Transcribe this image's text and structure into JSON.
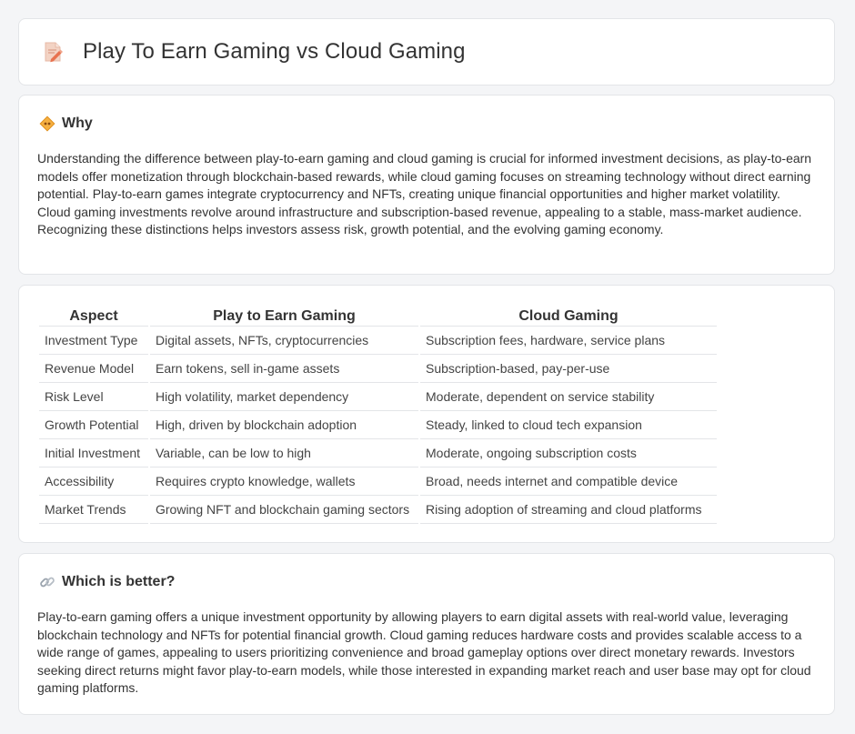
{
  "header": {
    "title": "Play To Earn Gaming vs Cloud Gaming",
    "icon": "document-pencil-icon"
  },
  "why": {
    "icon": "diamond-sign-icon",
    "heading": "Why",
    "text": "Understanding the difference between play-to-earn gaming and cloud gaming is crucial for informed investment decisions, as play-to-earn models offer monetization through blockchain-based rewards, while cloud gaming focuses on streaming technology without direct earning potential. Play-to-earn games integrate cryptocurrency and NFTs, creating unique financial opportunities and higher market volatility. Cloud gaming investments revolve around infrastructure and subscription-based revenue, appealing to a stable, mass-market audience. Recognizing these distinctions helps investors assess risk, growth potential, and the evolving gaming economy."
  },
  "table": {
    "headers": [
      "Aspect",
      "Play to Earn Gaming",
      "Cloud Gaming"
    ],
    "rows": [
      [
        "Investment Type",
        "Digital assets, NFTs, cryptocurrencies",
        "Subscription fees, hardware, service plans"
      ],
      [
        "Revenue Model",
        "Earn tokens, sell in-game assets",
        "Subscription-based, pay-per-use"
      ],
      [
        "Risk Level",
        "High volatility, market dependency",
        "Moderate, dependent on service stability"
      ],
      [
        "Growth Potential",
        "High, driven by blockchain adoption",
        "Steady, linked to cloud tech expansion"
      ],
      [
        "Initial Investment",
        "Variable, can be low to high",
        "Moderate, ongoing subscription costs"
      ],
      [
        "Accessibility",
        "Requires crypto knowledge, wallets",
        "Broad, needs internet and compatible device"
      ],
      [
        "Market Trends",
        "Growing NFT and blockchain gaming sectors",
        "Rising adoption of streaming and cloud platforms"
      ]
    ]
  },
  "better": {
    "icon": "link-icon",
    "heading": "Which is better?",
    "text": "Play-to-earn gaming offers a unique investment opportunity by allowing players to earn digital assets with real-world value, leveraging blockchain technology and NFTs for potential financial growth. Cloud gaming reduces hardware costs and provides scalable access to a wide range of games, appealing to users prioritizing convenience and broad gameplay options over direct monetary rewards. Investors seeking direct returns might favor play-to-earn models, while those interested in expanding market reach and user base may opt for cloud gaming platforms."
  }
}
